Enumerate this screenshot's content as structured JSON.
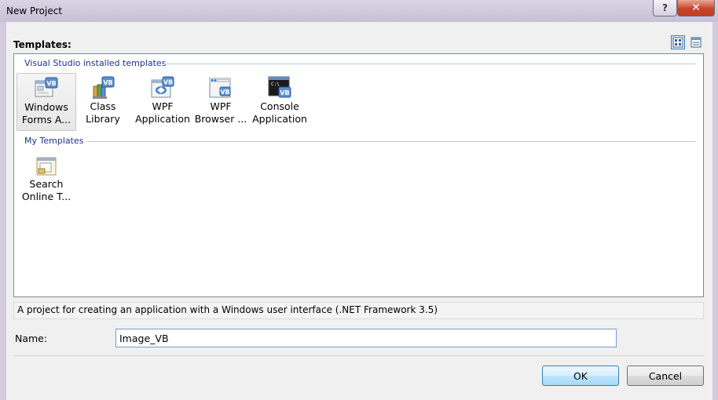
{
  "window": {
    "title": "New Project",
    "help_label": "?",
    "close_label": "✕"
  },
  "templates_label": "Templates:",
  "groups": [
    {
      "header": "Visual Studio installed templates"
    },
    {
      "header": "My Templates"
    }
  ],
  "installed_templates": [
    {
      "label": "Windows\nForms A...",
      "icon": "windows-forms-icon"
    },
    {
      "label": "Class\nLibrary",
      "icon": "class-library-icon"
    },
    {
      "label": "WPF\nApplication",
      "icon": "wpf-application-icon"
    },
    {
      "label": "WPF\nBrowser ...",
      "icon": "wpf-browser-icon"
    },
    {
      "label": "Console\nApplication",
      "icon": "console-application-icon"
    }
  ],
  "my_templates": [
    {
      "label": "Search\nOnline T...",
      "icon": "search-online-icon"
    }
  ],
  "description": "A project for creating an application with a Windows user interface (.NET Framework 3.5)",
  "name_field": {
    "label": "Name:",
    "value": "Image_VB"
  },
  "buttons": {
    "ok": "OK",
    "cancel": "Cancel"
  },
  "colors": {
    "group_header": "#1e3287",
    "accent": "#3c7fb1"
  }
}
